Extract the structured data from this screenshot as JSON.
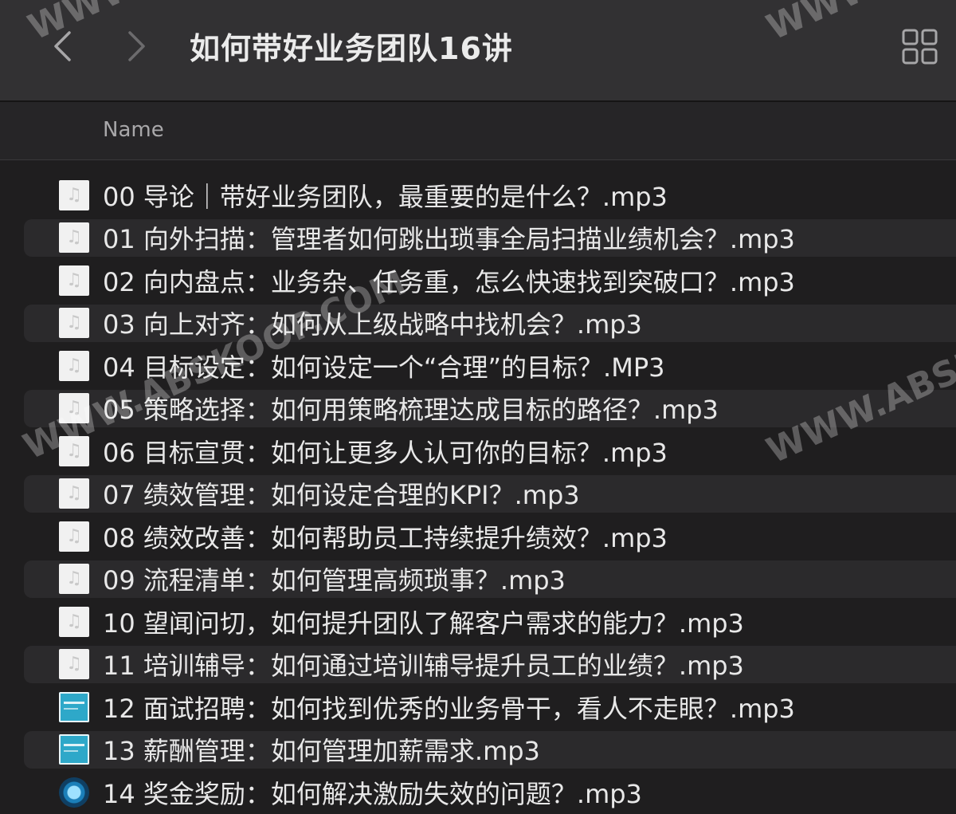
{
  "toolbar": {
    "title": "如何带好业务团队16讲"
  },
  "icons": {
    "back": "chevron-left-icon",
    "forward": "chevron-right-icon",
    "view": "grid-view-icon",
    "audio_file": "audio-file-icon",
    "video_thumb": "video-thumbnail-icon",
    "media_globe": "media-globe-icon"
  },
  "header": {
    "name_label": "Name"
  },
  "files": [
    {
      "name": "00  导论｜带好业务团队，最重要的是什么？.mp3",
      "icon": "audio"
    },
    {
      "name": "01  向外扫描：管理者如何跳出琐事全局扫描业绩机会？.mp3",
      "icon": "audio"
    },
    {
      "name": "02  向内盘点：业务杂、任务重，怎么快速找到突破口？.mp3",
      "icon": "audio"
    },
    {
      "name": "03  向上对齐：如何从上级战略中找机会？.mp3",
      "icon": "audio"
    },
    {
      "name": "04  目标设定：如何设定一个“合理”的目标？.MP3",
      "icon": "audio"
    },
    {
      "name": "05  策略选择：如何用策略梳理达成目标的路径？.mp3",
      "icon": "audio"
    },
    {
      "name": "06  目标宣贯：如何让更多人认可你的目标？.mp3",
      "icon": "audio"
    },
    {
      "name": "07  绩效管理：如何设定合理的KPI？.mp3",
      "icon": "audio"
    },
    {
      "name": "08  绩效改善：如何帮助员工持续提升绩效？.mp3",
      "icon": "audio"
    },
    {
      "name": "09  流程清单：如何管理高频琐事？.mp3",
      "icon": "audio"
    },
    {
      "name": "10  望闻问切，如何提升团队了解客户需求的能力？.mp3",
      "icon": "audio"
    },
    {
      "name": "11  培训辅导：如何通过培训辅导提升员工的业绩？.mp3",
      "icon": "audio"
    },
    {
      "name": "12  面试招聘：如何找到优秀的业务骨干，看人不走眼？.mp3",
      "icon": "thumb"
    },
    {
      "name": "13  薪酬管理：如何管理加薪需求.mp3",
      "icon": "thumb"
    },
    {
      "name": "14 奖金奖励：如何解决激励失效的问题？.mp3",
      "icon": "globe"
    }
  ],
  "watermarks": [
    "WWW.ABSKOOP.COM",
    "WWW.ABSKOOP.COM",
    "WWW.",
    "WWW."
  ]
}
